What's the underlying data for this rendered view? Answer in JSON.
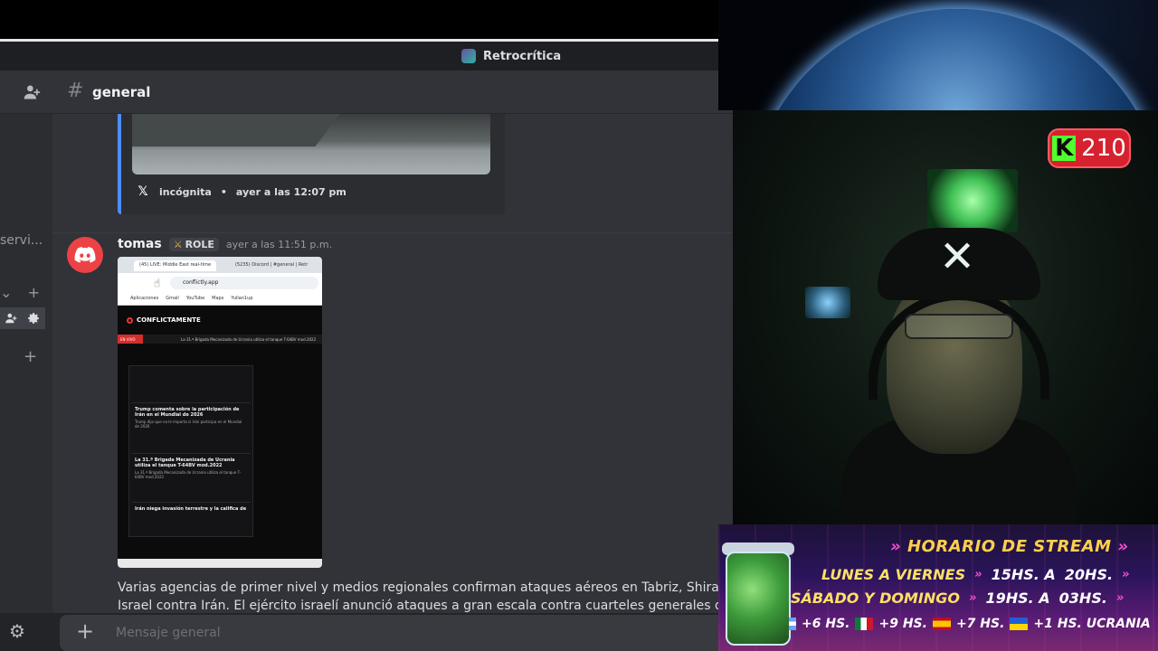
{
  "server": {
    "name": "Retrocrítica"
  },
  "channel": {
    "name": "general",
    "hash": "#"
  },
  "sidebar": {
    "partial_text": "servi...",
    "row1_left": "⌄",
    "row1_right": "+",
    "add_label": "+"
  },
  "embed": {
    "author": "incógnita",
    "timestamp": "ayer a las 12:07 pm"
  },
  "message": {
    "username": "tomas",
    "role": "ROLE",
    "timestamp": "ayer a las 11:51 p.m.",
    "text_line1": "Varias agencias de primer nivel y medios regionales confirman ataques aéreos en Tabriz, Shiraz e Isf",
    "text_line2": "Israel contra Irán. El ejército israelí anunció ataques a gran escala contra cuarteles generales de se"
  },
  "attachment": {
    "tab1": "(45) LIVE: Middle East real-time",
    "tab2": "(5235) Discord | #general | Retr",
    "url": "conflictly.app",
    "bookmarks": [
      "Aplicaciones",
      "Gmail",
      "YouTube",
      "Maps",
      "Yulian1up"
    ],
    "brand": "CONFLICTAMENTE",
    "live": "EN VIVO",
    "ticker": "La 31.ª Brigada Mecanizada de Ucrania utiliza el tanque T-64BV mod.2022",
    "cards": [
      {
        "title": "Trump comenta sobre la participación de Irán en el Mundial de 2026",
        "body": "Trump dijo que no le importa si Irán participa en el Mundial de 2026"
      },
      {
        "title": "La 31.ª Brigada Mecanizada de Ucrania utiliza el tanque T-64BV mod.2022",
        "body": "La 31.ª Brigada Mecanizada de Ucrania utiliza el tanque T-64BV mod.2022"
      },
      {
        "title": "Irán niega invasión terrestre y la califica de",
        "body": ""
      }
    ]
  },
  "composer": {
    "placeholder": "Mensaje general"
  },
  "overlay": {
    "kick_count": "210",
    "schedule_title": "HORARIO DE STREAM",
    "rows": [
      {
        "day": "LUNES A VIERNES",
        "from": "15HS. A",
        "to": "20HS."
      },
      {
        "day": "SÁBADO Y DOMINGO",
        "from": "19HS. A",
        "to": "03HS."
      }
    ],
    "tz": {
      "a": "+6 HS.",
      "b": "+9 HS.",
      "c": "+7 HS.",
      "d": "+1 HS. UCRANIA"
    }
  },
  "colors": {
    "accent": "#5865f2",
    "kick_green": "#52ff2e",
    "kick_red": "#d5222e",
    "schedule_yellow": "#ffd04a",
    "discord_red": "#ed4245"
  }
}
